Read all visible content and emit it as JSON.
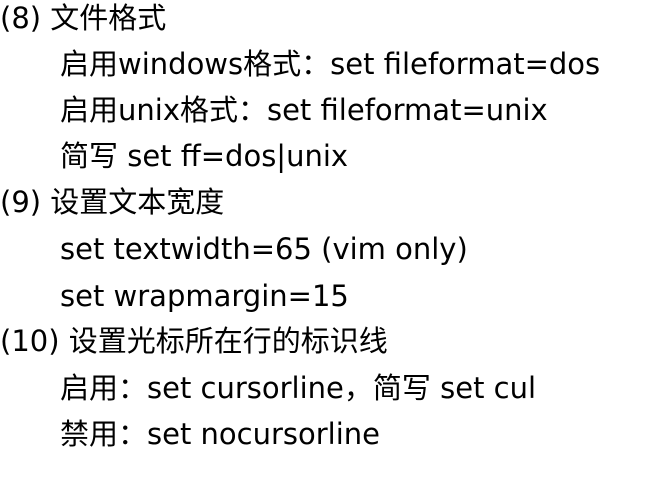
{
  "sections": [
    {
      "heading": "(8) 文件格式",
      "items": [
        "启用windows格式：set  fileformat=dos",
        "启用unix格式：set fileformat=unix",
        "简写 set ff=dos|unix"
      ]
    },
    {
      "heading": "(9) 设置文本宽度",
      "items": [
        "set textwidth=65 (vim only)",
        "set wrapmargin=15"
      ]
    },
    {
      "heading": "(10) 设置光标所在行的标识线",
      "items": [
        "启用：set cursorline，简写 set cul",
        "禁用：set nocursorline"
      ]
    }
  ]
}
